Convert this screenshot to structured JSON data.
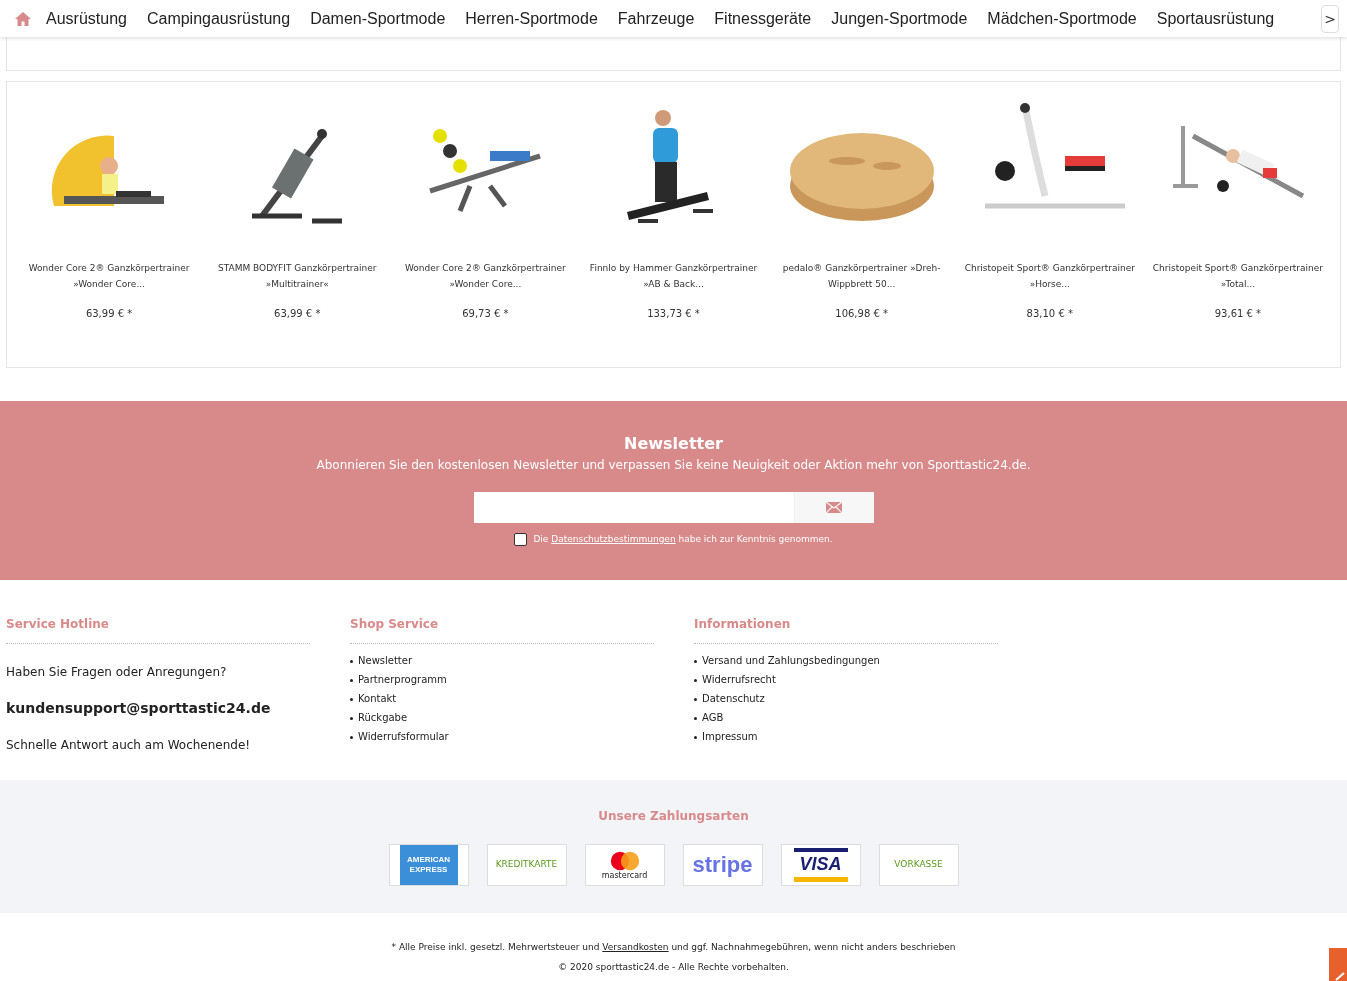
{
  "nav": {
    "items": [
      "Ausrüstung",
      "Campingausrüstung",
      "Damen-Sportmode",
      "Herren-Sportmode",
      "Fahrzeuge",
      "Fitnessgeräte",
      "Jungen-Sportmode",
      "Mädchen-Sportmode",
      "Sportausrüstung"
    ],
    "next": ">"
  },
  "products": [
    {
      "title": "Wonder Core 2® Ganzkörpertrainer »Wonder Core...",
      "price": "63,99 € *",
      "kind": "picture"
    },
    {
      "title": "STAMM BODYFIT Ganzkörpertrainer »Multitrainer«",
      "price": "63,99 € *",
      "kind": "picture"
    },
    {
      "title": "Wonder Core 2® Ganzkörpertrainer »Wonder Core...",
      "price": "69,73 € *",
      "kind": "picture"
    },
    {
      "title": "Finnlo by Hammer Ganzkörpertrainer »AB & Back...",
      "price": "133,73 € *",
      "kind": "picture"
    },
    {
      "title": "pedalo® Ganzkörpertrainer »Dreh-Wippbrett 50...",
      "price": "106,98 € *",
      "kind": "picture"
    },
    {
      "title": "Christopeit Sport® Ganzkörpertrainer »Horse...",
      "price": "83,10 € *",
      "kind": "picture"
    },
    {
      "title": "Christopeit Sport® Ganzkörpertrainer »Total...",
      "price": "93,61 € *",
      "kind": "picture"
    }
  ],
  "newsletter": {
    "title": "Newsletter",
    "text": "Abonnieren Sie den kostenlosen Newsletter und verpassen Sie keine Neuigkeit oder Aktion mehr von Sporttastic24.de.",
    "consent_before": "Die",
    "consent_link": "Datenschutzbestimmungen",
    "consent_after": "habe ich zur Kenntnis genommen.",
    "checked": false
  },
  "footer": {
    "hotline": {
      "title": "Service Hotline",
      "question": "Haben Sie Fragen oder Anregungen?",
      "email": "kundensupport@sporttastic24.de",
      "note": "Schnelle Antwort auch am Wochenende!"
    },
    "shop_service": {
      "title": "Shop Service",
      "items": [
        "Newsletter",
        "Partnerprogramm",
        "Kontakt",
        "Rückgabe",
        "Widerrufsformular"
      ]
    },
    "informationen": {
      "title": "Informationen",
      "items": [
        "Versand und Zahlungsbedingungen",
        "Widerrufsrecht",
        "Datenschutz",
        "AGB",
        "Impressum"
      ]
    }
  },
  "payments": {
    "title": "Unsere Zahlungsarten",
    "methods": [
      {
        "kind": "amex",
        "label": "AMERICAN EXPRESS"
      },
      {
        "kind": "plain",
        "label": "KREDITKARTE"
      },
      {
        "kind": "mastercard",
        "label": "mastercard"
      },
      {
        "kind": "stripe",
        "label": "stripe"
      },
      {
        "kind": "visa",
        "label": "VISA"
      },
      {
        "kind": "plain",
        "label": "VORKASSE"
      }
    ]
  },
  "legal": {
    "before": "* Alle Preise inkl. gesetzl. Mehrwertsteuer und",
    "link": "Versandkosten",
    "after": "und ggf. Nachnahmegebühren, wenn nicht anders beschrieben",
    "copyright": "© 2020 sporttastic24.de - Alle Rechte vorbehalten."
  }
}
